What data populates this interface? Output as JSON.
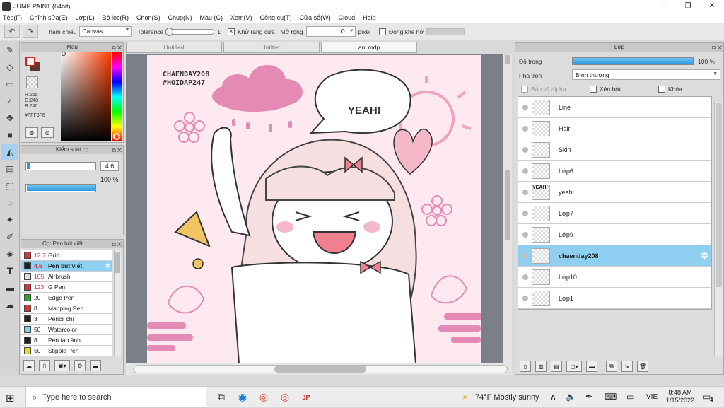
{
  "window": {
    "title": "JUMP PAINT (64bit)",
    "min": "—",
    "max": "❐",
    "close": "✕"
  },
  "menu": [
    "Tệp(F)",
    "Chỉnh sửa(E)",
    "Lớp(L)",
    "Bộ lọc(R)",
    "Chọn(S)",
    "Chụp(N)",
    "Màu (C)",
    "Xem(V)",
    "Công cụ(T)",
    "Cửa sổ(W)",
    "Cloud",
    "Help"
  ],
  "toolbar": {
    "reference_label": "Tham chiếu",
    "reference_value": "Canvas",
    "tolerance_label": "Tolerance",
    "tolerance_value": "1",
    "antialias_label": "Khử răng cưa",
    "expand_label": "Mở rộng",
    "expand_value": "0",
    "expand_unit": "pixel",
    "close_gap_label": "Đóng khe hở"
  },
  "color_panel": {
    "title": "Màu",
    "r": "R:255",
    "g": "G:248",
    "b": "B:246",
    "hex": "#FFF8F6"
  },
  "brush_control": {
    "title": "Kiểm soát cọ",
    "size": "4.6",
    "opacity": "100 %",
    "opacity_fraction": 1.0
  },
  "brush_list": {
    "title": "Cọ: Pen bút viết",
    "items": [
      {
        "size": "12.7",
        "name": "Grid",
        "color": "#e03030",
        "red": true
      },
      {
        "size": "4.6",
        "name": "Pen bút viết",
        "color": "#222222",
        "red": true,
        "selected": true
      },
      {
        "size": "105",
        "name": "Airbrush",
        "color": "#dddddd",
        "red": true
      },
      {
        "size": "123",
        "name": "G Pen",
        "color": "#e03030",
        "red": true
      },
      {
        "size": "20",
        "name": "Edge Pen",
        "color": "#22aa22"
      },
      {
        "size": "8",
        "name": "Mapping Pen",
        "color": "#e03030"
      },
      {
        "size": "3",
        "name": "Pencil chì",
        "color": "#222222"
      },
      {
        "size": "50",
        "name": "Watercolor",
        "color": "#7fd0f0"
      },
      {
        "size": "8",
        "name": "Pen tạo ảnh",
        "color": "#222222"
      },
      {
        "size": "50",
        "name": "Stipple Pen",
        "color": "#e0e020"
      }
    ]
  },
  "tabs": [
    "Untitled",
    "Untitled",
    "ani.mdp"
  ],
  "canvas": {
    "watermark1": "CHAENDAY208",
    "watermark2": "#HOIDAP247",
    "bubble": "YEAH!"
  },
  "layer_panel": {
    "title": "Lớp",
    "opacity_label": "Độ trong",
    "opacity_value": "100 %",
    "blend_label": "Pha trộn",
    "blend_value": "Bình thường",
    "protect_alpha": "Bảo vệ alpha",
    "clipping": "Xén bớt",
    "lock": "Khóa",
    "layers": [
      {
        "name": "Line"
      },
      {
        "name": "Hair"
      },
      {
        "name": "Skin"
      },
      {
        "name": "Lớp6"
      },
      {
        "name": "yeah!",
        "thumb": "YEAH!"
      },
      {
        "name": "Lớp7"
      },
      {
        "name": "Lớp9"
      },
      {
        "name": "chaenday208",
        "selected": true
      },
      {
        "name": "Lớp10"
      },
      {
        "name": "Lớp1"
      }
    ]
  },
  "taskbar": {
    "search_placeholder": "Type here to search",
    "weather": "74°F  Mostly sunny",
    "lang": "VIE",
    "time": "8:48 AM",
    "date": "1/15/2022",
    "notif_count": "4"
  }
}
